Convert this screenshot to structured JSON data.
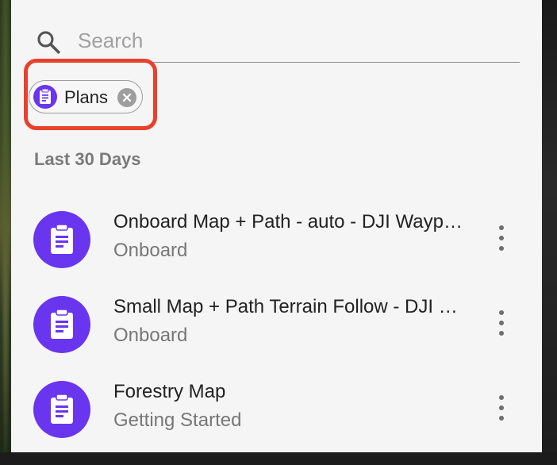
{
  "search": {
    "placeholder": "Search",
    "value": ""
  },
  "filter_chip": {
    "label": "Plans",
    "icon": "clipboard-icon",
    "close_icon": "close-circle-icon"
  },
  "section": {
    "title": "Last 30 Days"
  },
  "items": [
    {
      "title": "Onboard Map + Path - auto - DJI Waypoints",
      "subtitle": "Onboard",
      "icon": "clipboard-icon"
    },
    {
      "title": "Small Map + Path Terrain Follow - DJI Waypoints",
      "subtitle": "Onboard",
      "icon": "clipboard-icon"
    },
    {
      "title": "Forestry Map",
      "subtitle": "Getting Started",
      "icon": "clipboard-icon"
    }
  ],
  "colors": {
    "accent": "#6a35ef",
    "highlight": "#e8412c",
    "panel": "#f5f5f5"
  }
}
